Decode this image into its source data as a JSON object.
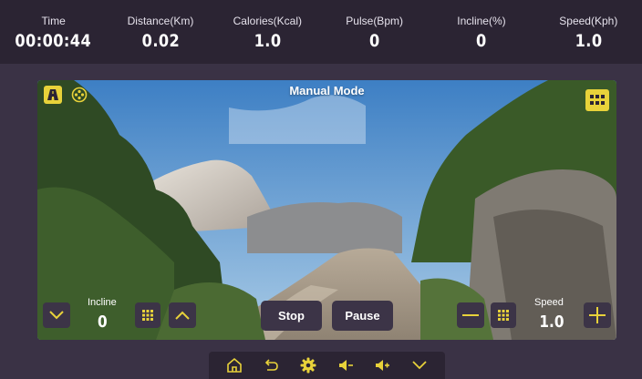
{
  "stats": [
    {
      "label": "Time",
      "value": "00:00:44"
    },
    {
      "label": "Distance(Km)",
      "value": "0.02"
    },
    {
      "label": "Calories(Kcal)",
      "value": "1.0"
    },
    {
      "label": "Pulse(Bpm)",
      "value": "0"
    },
    {
      "label": "Incline(%)",
      "value": "0"
    },
    {
      "label": "Speed(Kph)",
      "value": "1.0"
    }
  ],
  "video": {
    "mode_title": "Manual Mode",
    "top_left_icons": [
      "road-icon",
      "film-reel-icon"
    ],
    "top_right_icon": "grid-menu-icon"
  },
  "incline": {
    "label": "Incline",
    "value": "0"
  },
  "speed": {
    "label": "Speed",
    "value": "1.0"
  },
  "actions": {
    "stop_label": "Stop",
    "pause_label": "Pause"
  },
  "bottom_nav": [
    "home-icon",
    "back-icon",
    "settings-icon",
    "volume-down-icon",
    "volume-up-icon",
    "collapse-icon"
  ],
  "colors": {
    "accent": "#e8d23a",
    "background": "#3a3245",
    "bar": "#2b2433",
    "button": "#3c3447"
  }
}
